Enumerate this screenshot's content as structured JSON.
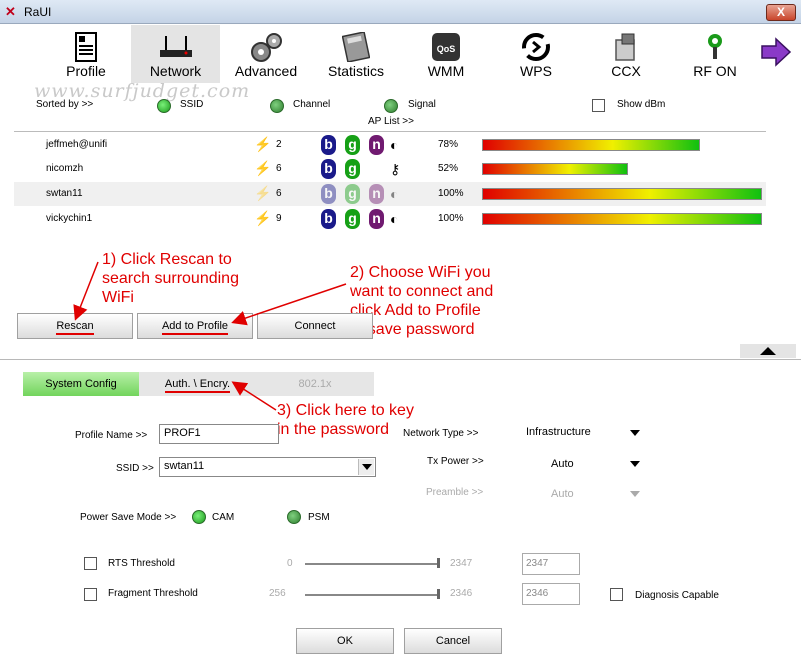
{
  "window": {
    "title": "RaUI",
    "close_label": "X"
  },
  "toolbar": {
    "items": [
      {
        "label": "Profile",
        "icon": "profile-icon"
      },
      {
        "label": "Network",
        "icon": "router-icon"
      },
      {
        "label": "Advanced",
        "icon": "gears-icon"
      },
      {
        "label": "Statistics",
        "icon": "calculator-icon"
      },
      {
        "label": "WMM",
        "icon": "qos-icon"
      },
      {
        "label": "WPS",
        "icon": "wps-icon"
      },
      {
        "label": "CCX",
        "icon": "ccx-icon"
      },
      {
        "label": "RF ON",
        "icon": "antenna-icon"
      }
    ],
    "active": "Network",
    "next_icon": "right-arrow-icon"
  },
  "watermark": "www.surfjudget.com",
  "sort": {
    "label": "Sorted by >>",
    "options": [
      "SSID",
      "Channel",
      "Signal"
    ],
    "show_dbm_label": "Show dBm"
  },
  "ap_list": {
    "title": "AP List >>",
    "rows": [
      {
        "ssid": "jeffmeh@unifi",
        "channel": "2",
        "signal": "78%",
        "signal_fraction": 0.78,
        "security": "wps"
      },
      {
        "ssid": "nicomzh",
        "channel": "6",
        "signal": "52%",
        "signal_fraction": 0.52,
        "security": "key"
      },
      {
        "ssid": "swtan11",
        "channel": "6",
        "signal": "100%",
        "signal_fraction": 1.0,
        "security": "wps"
      },
      {
        "ssid": "vickychin1",
        "channel": "9",
        "signal": "100%",
        "signal_fraction": 1.0,
        "security": "wps"
      }
    ],
    "badges": [
      "b",
      "g",
      "n"
    ]
  },
  "buttons": {
    "rescan": "Rescan",
    "add_profile": "Add to Profile",
    "connect": "Connect",
    "ok": "OK",
    "cancel": "Cancel"
  },
  "annotations": {
    "a1": [
      "1) Click Rescan to",
      "search surrounding",
      "WiFi"
    ],
    "a2": [
      "2) Choose WiFi you",
      "want to connect and",
      "click Add to Profile",
      "to save password"
    ],
    "a3": [
      "3) Click here to key",
      "in the password"
    ]
  },
  "config_tabs": [
    "System Config",
    "Auth. \\ Encry.",
    "802.1x"
  ],
  "form": {
    "profile_name_label": "Profile Name >>",
    "profile_name_value": "PROF1",
    "ssid_label": "SSID >>",
    "ssid_value": "swtan11",
    "network_type_label": "Network Type >>",
    "network_type_value": "Infrastructure",
    "tx_power_label": "Tx Power >>",
    "tx_power_value": "Auto",
    "preamble_label": "Preamble >>",
    "preamble_value": "Auto",
    "power_save_label": "Power Save Mode >>",
    "power_save_options": [
      "CAM",
      "PSM"
    ],
    "rts_label": "RTS Threshold",
    "rts_min": "0",
    "rts_max": "2347",
    "rts_value": "2347",
    "frag_label": "Fragment Threshold",
    "frag_min": "256",
    "frag_max": "2346",
    "frag_value": "2346",
    "diagnosis_label": "Diagnosis Capable"
  },
  "colors": {
    "annotation": "#e00000",
    "active_tab": "#72d45c"
  }
}
